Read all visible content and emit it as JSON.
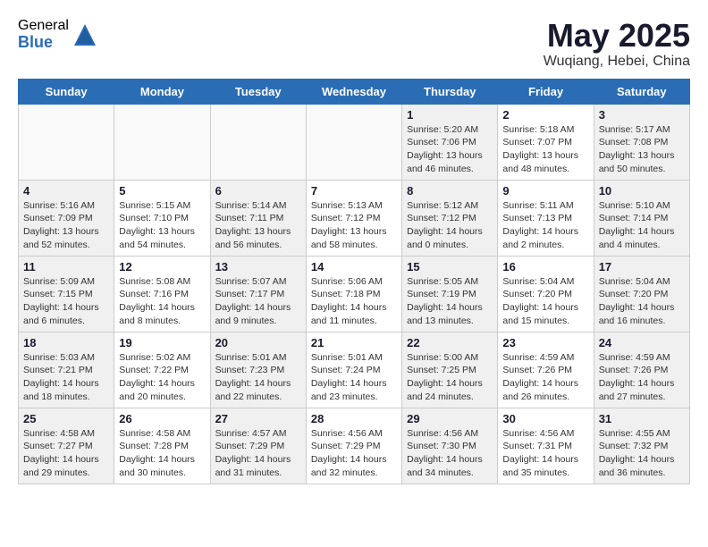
{
  "header": {
    "logo_general": "General",
    "logo_blue": "Blue",
    "month_title": "May 2025",
    "location": "Wuqiang, Hebei, China"
  },
  "weekdays": [
    "Sunday",
    "Monday",
    "Tuesday",
    "Wednesday",
    "Thursday",
    "Friday",
    "Saturday"
  ],
  "weeks": [
    [
      {
        "day": "",
        "info": ""
      },
      {
        "day": "",
        "info": ""
      },
      {
        "day": "",
        "info": ""
      },
      {
        "day": "",
        "info": ""
      },
      {
        "day": "1",
        "info": "Sunrise: 5:20 AM\nSunset: 7:06 PM\nDaylight: 13 hours\nand 46 minutes."
      },
      {
        "day": "2",
        "info": "Sunrise: 5:18 AM\nSunset: 7:07 PM\nDaylight: 13 hours\nand 48 minutes."
      },
      {
        "day": "3",
        "info": "Sunrise: 5:17 AM\nSunset: 7:08 PM\nDaylight: 13 hours\nand 50 minutes."
      }
    ],
    [
      {
        "day": "4",
        "info": "Sunrise: 5:16 AM\nSunset: 7:09 PM\nDaylight: 13 hours\nand 52 minutes."
      },
      {
        "day": "5",
        "info": "Sunrise: 5:15 AM\nSunset: 7:10 PM\nDaylight: 13 hours\nand 54 minutes."
      },
      {
        "day": "6",
        "info": "Sunrise: 5:14 AM\nSunset: 7:11 PM\nDaylight: 13 hours\nand 56 minutes."
      },
      {
        "day": "7",
        "info": "Sunrise: 5:13 AM\nSunset: 7:12 PM\nDaylight: 13 hours\nand 58 minutes."
      },
      {
        "day": "8",
        "info": "Sunrise: 5:12 AM\nSunset: 7:12 PM\nDaylight: 14 hours\nand 0 minutes."
      },
      {
        "day": "9",
        "info": "Sunrise: 5:11 AM\nSunset: 7:13 PM\nDaylight: 14 hours\nand 2 minutes."
      },
      {
        "day": "10",
        "info": "Sunrise: 5:10 AM\nSunset: 7:14 PM\nDaylight: 14 hours\nand 4 minutes."
      }
    ],
    [
      {
        "day": "11",
        "info": "Sunrise: 5:09 AM\nSunset: 7:15 PM\nDaylight: 14 hours\nand 6 minutes."
      },
      {
        "day": "12",
        "info": "Sunrise: 5:08 AM\nSunset: 7:16 PM\nDaylight: 14 hours\nand 8 minutes."
      },
      {
        "day": "13",
        "info": "Sunrise: 5:07 AM\nSunset: 7:17 PM\nDaylight: 14 hours\nand 9 minutes."
      },
      {
        "day": "14",
        "info": "Sunrise: 5:06 AM\nSunset: 7:18 PM\nDaylight: 14 hours\nand 11 minutes."
      },
      {
        "day": "15",
        "info": "Sunrise: 5:05 AM\nSunset: 7:19 PM\nDaylight: 14 hours\nand 13 minutes."
      },
      {
        "day": "16",
        "info": "Sunrise: 5:04 AM\nSunset: 7:20 PM\nDaylight: 14 hours\nand 15 minutes."
      },
      {
        "day": "17",
        "info": "Sunrise: 5:04 AM\nSunset: 7:20 PM\nDaylight: 14 hours\nand 16 minutes."
      }
    ],
    [
      {
        "day": "18",
        "info": "Sunrise: 5:03 AM\nSunset: 7:21 PM\nDaylight: 14 hours\nand 18 minutes."
      },
      {
        "day": "19",
        "info": "Sunrise: 5:02 AM\nSunset: 7:22 PM\nDaylight: 14 hours\nand 20 minutes."
      },
      {
        "day": "20",
        "info": "Sunrise: 5:01 AM\nSunset: 7:23 PM\nDaylight: 14 hours\nand 22 minutes."
      },
      {
        "day": "21",
        "info": "Sunrise: 5:01 AM\nSunset: 7:24 PM\nDaylight: 14 hours\nand 23 minutes."
      },
      {
        "day": "22",
        "info": "Sunrise: 5:00 AM\nSunset: 7:25 PM\nDaylight: 14 hours\nand 24 minutes."
      },
      {
        "day": "23",
        "info": "Sunrise: 4:59 AM\nSunset: 7:26 PM\nDaylight: 14 hours\nand 26 minutes."
      },
      {
        "day": "24",
        "info": "Sunrise: 4:59 AM\nSunset: 7:26 PM\nDaylight: 14 hours\nand 27 minutes."
      }
    ],
    [
      {
        "day": "25",
        "info": "Sunrise: 4:58 AM\nSunset: 7:27 PM\nDaylight: 14 hours\nand 29 minutes."
      },
      {
        "day": "26",
        "info": "Sunrise: 4:58 AM\nSunset: 7:28 PM\nDaylight: 14 hours\nand 30 minutes."
      },
      {
        "day": "27",
        "info": "Sunrise: 4:57 AM\nSunset: 7:29 PM\nDaylight: 14 hours\nand 31 minutes."
      },
      {
        "day": "28",
        "info": "Sunrise: 4:56 AM\nSunset: 7:29 PM\nDaylight: 14 hours\nand 32 minutes."
      },
      {
        "day": "29",
        "info": "Sunrise: 4:56 AM\nSunset: 7:30 PM\nDaylight: 14 hours\nand 34 minutes."
      },
      {
        "day": "30",
        "info": "Sunrise: 4:56 AM\nSunset: 7:31 PM\nDaylight: 14 hours\nand 35 minutes."
      },
      {
        "day": "31",
        "info": "Sunrise: 4:55 AM\nSunset: 7:32 PM\nDaylight: 14 hours\nand 36 minutes."
      }
    ]
  ]
}
